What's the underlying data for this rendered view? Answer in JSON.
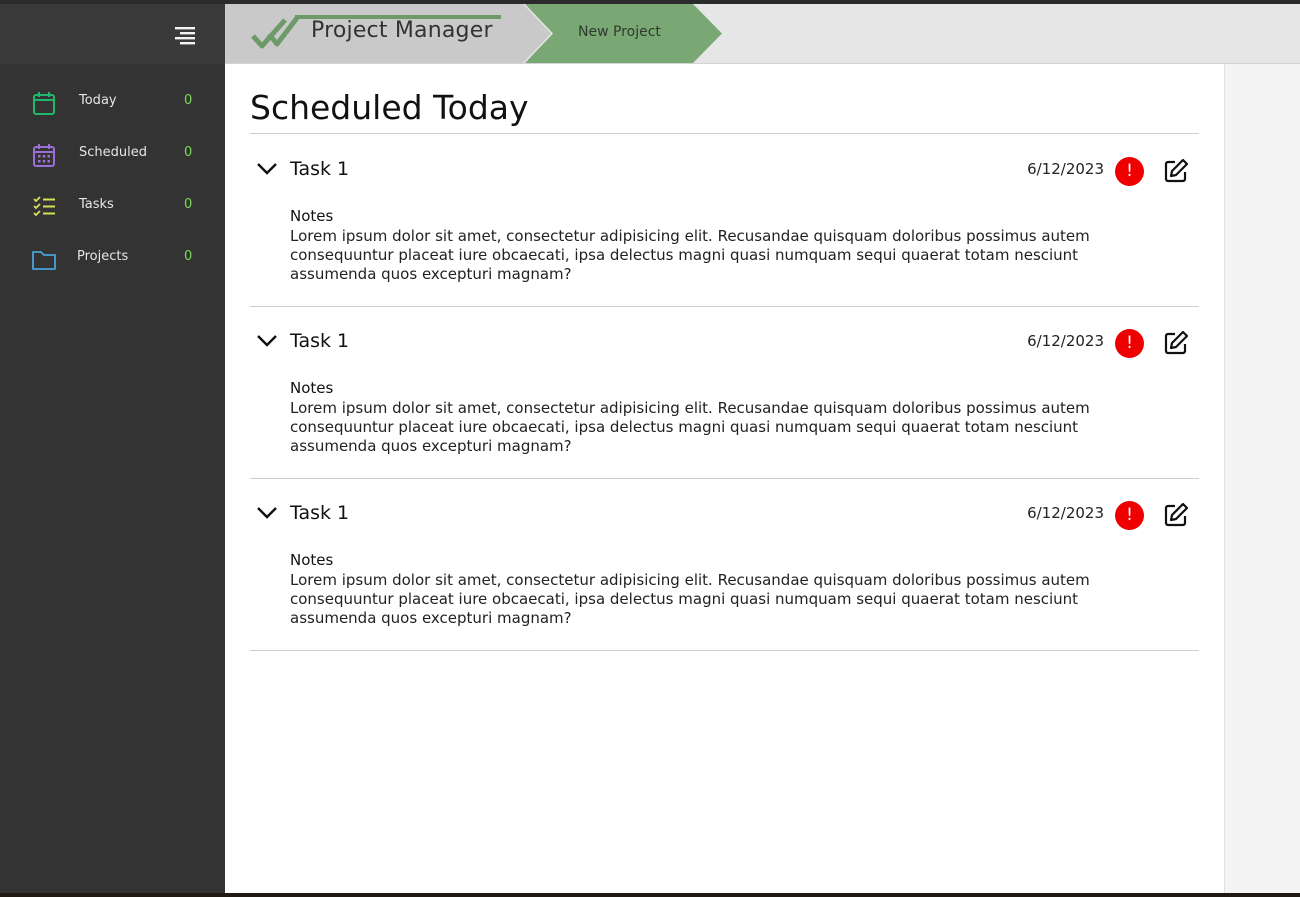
{
  "app": {
    "title": "Project Manager",
    "new_project_label": "New Project"
  },
  "sidebar": {
    "items": [
      {
        "label": "Today",
        "count": "0",
        "icon": "calendar-icon",
        "color": "#1fb86a"
      },
      {
        "label": "Scheduled",
        "count": "0",
        "icon": "calendar-grid-icon",
        "color": "#9b6fd6"
      },
      {
        "label": "Tasks",
        "count": "0",
        "icon": "checklist-icon",
        "color": "#d6e05a"
      },
      {
        "label": "Projects",
        "count": "0",
        "icon": "folder-icon",
        "color": "#4aa3d8"
      }
    ]
  },
  "main": {
    "title": "Scheduled Today",
    "tasks": [
      {
        "name": "Task 1",
        "date": "6/12/2023",
        "priority_symbol": "!",
        "notes_label": "Notes",
        "notes": "Lorem ipsum dolor sit amet, consectetur adipisicing elit. Recusandae quisquam doloribus possimus autem consequuntur placeat iure obcaecati, ipsa delectus magni quasi numquam sequi quaerat totam nesciunt assumenda quos excepturi magnam?"
      },
      {
        "name": "Task 1",
        "date": "6/12/2023",
        "priority_symbol": "!",
        "notes_label": "Notes",
        "notes": "Lorem ipsum dolor sit amet, consectetur adipisicing elit. Recusandae quisquam doloribus possimus autem consequuntur placeat iure obcaecati, ipsa delectus magni quasi numquam sequi quaerat totam nesciunt assumenda quos excepturi magnam?"
      },
      {
        "name": "Task 1",
        "date": "6/12/2023",
        "priority_symbol": "!",
        "notes_label": "Notes",
        "notes": "Lorem ipsum dolor sit amet, consectetur adipisicing elit. Recusandae quisquam doloribus possimus autem consequuntur placeat iure obcaecati, ipsa delectus magni quasi numquam sequi quaerat totam nesciunt assumenda quos excepturi magnam?"
      }
    ]
  },
  "colors": {
    "accent_green": "#7aa874",
    "count_green": "#7ed957",
    "alert_red": "#ee0000",
    "sidebar_bg": "#333333"
  }
}
